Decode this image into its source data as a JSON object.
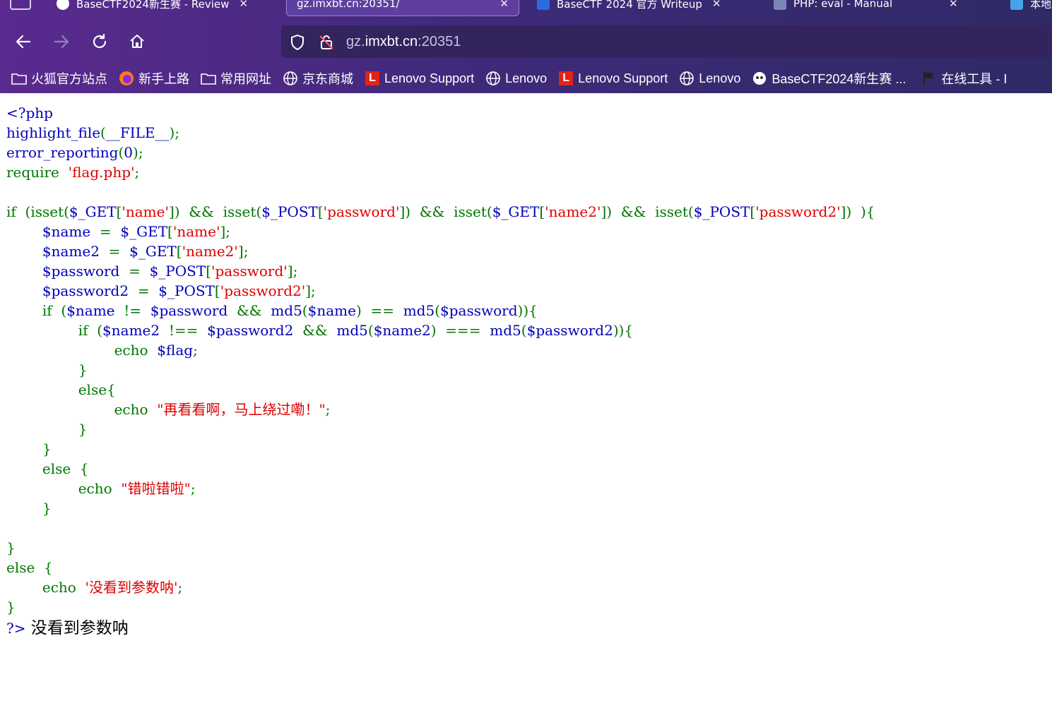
{
  "browser": {
    "tabs": [
      {
        "label": "BaseCTF2024新生赛 - Review",
        "active": false
      },
      {
        "label": "gz.imxbt.cn:20351/",
        "active": true
      },
      {
        "label": "BaseCTF 2024 官方 Writeup",
        "active": false
      },
      {
        "label": "PHP: eval - Manual",
        "active": false
      },
      {
        "label": "本地",
        "active": false
      }
    ],
    "url": {
      "scheme_host_prefix": "gz.",
      "host": "imxbt.cn",
      "port": ":20351"
    },
    "bookmarks": [
      {
        "label": "火狐官方站点",
        "icon": "folder-icon"
      },
      {
        "label": "新手上路",
        "icon": "firefox-icon"
      },
      {
        "label": "常用网址",
        "icon": "folder-icon"
      },
      {
        "label": "京东商城",
        "icon": "globe-icon"
      },
      {
        "label": "Lenovo Support",
        "icon": "lenovo-icon"
      },
      {
        "label": "Lenovo",
        "icon": "globe-icon"
      },
      {
        "label": "Lenovo Support",
        "icon": "lenovo-icon"
      },
      {
        "label": "Lenovo",
        "icon": "globe-icon"
      },
      {
        "label": "BaseCTF2024新生赛 ...",
        "icon": "basectf-icon"
      },
      {
        "label": "在线工具 - I",
        "icon": "flag-icon"
      }
    ]
  },
  "page": {
    "code_lines": [
      [
        [
          "d",
          "<?php"
        ]
      ],
      [
        [
          "d",
          "highlight_file"
        ],
        [
          "k",
          "("
        ],
        [
          "d",
          "__FILE__"
        ],
        [
          "k",
          ");"
        ]
      ],
      [
        [
          "d",
          "error_reporting"
        ],
        [
          "k",
          "("
        ],
        [
          "d",
          "0"
        ],
        [
          "k",
          ");"
        ]
      ],
      [
        [
          "k",
          "require  "
        ],
        [
          "s",
          "'flag.php'"
        ],
        [
          "k",
          ";"
        ]
      ],
      [],
      [
        [
          "k",
          "if  (isset("
        ],
        [
          "d",
          "$_GET"
        ],
        [
          "k",
          "["
        ],
        [
          "s",
          "'name'"
        ],
        [
          "k",
          "])  &&  isset("
        ],
        [
          "d",
          "$_POST"
        ],
        [
          "k",
          "["
        ],
        [
          "s",
          "'password'"
        ],
        [
          "k",
          "])  &&  isset("
        ],
        [
          "d",
          "$_GET"
        ],
        [
          "k",
          "["
        ],
        [
          "s",
          "'name2'"
        ],
        [
          "k",
          "])  &&  isset("
        ],
        [
          "d",
          "$_POST"
        ],
        [
          "k",
          "["
        ],
        [
          "s",
          "'password2'"
        ],
        [
          "k",
          "])  ){"
        ]
      ],
      [
        [
          "k",
          "        "
        ],
        [
          "d",
          "$name  "
        ],
        [
          "k",
          "=  "
        ],
        [
          "d",
          "$_GET"
        ],
        [
          "k",
          "["
        ],
        [
          "s",
          "'name'"
        ],
        [
          "k",
          "];"
        ]
      ],
      [
        [
          "k",
          "        "
        ],
        [
          "d",
          "$name2  "
        ],
        [
          "k",
          "=  "
        ],
        [
          "d",
          "$_GET"
        ],
        [
          "k",
          "["
        ],
        [
          "s",
          "'name2'"
        ],
        [
          "k",
          "];"
        ]
      ],
      [
        [
          "k",
          "        "
        ],
        [
          "d",
          "$password  "
        ],
        [
          "k",
          "=  "
        ],
        [
          "d",
          "$_POST"
        ],
        [
          "k",
          "["
        ],
        [
          "s",
          "'password'"
        ],
        [
          "k",
          "];"
        ]
      ],
      [
        [
          "k",
          "        "
        ],
        [
          "d",
          "$password2  "
        ],
        [
          "k",
          "=  "
        ],
        [
          "d",
          "$_POST"
        ],
        [
          "k",
          "["
        ],
        [
          "s",
          "'password2'"
        ],
        [
          "k",
          "];"
        ]
      ],
      [
        [
          "k",
          "        if  ("
        ],
        [
          "d",
          "$name  "
        ],
        [
          "k",
          "!=  "
        ],
        [
          "d",
          "$password  "
        ],
        [
          "k",
          "&&  "
        ],
        [
          "d",
          "md5"
        ],
        [
          "k",
          "("
        ],
        [
          "d",
          "$name"
        ],
        [
          "k",
          ")  ==  "
        ],
        [
          "d",
          "md5"
        ],
        [
          "k",
          "("
        ],
        [
          "d",
          "$password"
        ],
        [
          "k",
          ")){"
        ]
      ],
      [
        [
          "k",
          "                if  ("
        ],
        [
          "d",
          "$name2  "
        ],
        [
          "k",
          "!==  "
        ],
        [
          "d",
          "$password2  "
        ],
        [
          "k",
          "&&  "
        ],
        [
          "d",
          "md5"
        ],
        [
          "k",
          "("
        ],
        [
          "d",
          "$name2"
        ],
        [
          "k",
          ")  ===  "
        ],
        [
          "d",
          "md5"
        ],
        [
          "k",
          "("
        ],
        [
          "d",
          "$password2"
        ],
        [
          "k",
          ")){"
        ]
      ],
      [
        [
          "k",
          "                        echo  "
        ],
        [
          "d",
          "$flag"
        ],
        [
          "k",
          ";"
        ]
      ],
      [
        [
          "k",
          "                }"
        ]
      ],
      [
        [
          "k",
          "                else{"
        ]
      ],
      [
        [
          "k",
          "                        echo  "
        ],
        [
          "s",
          "\"再看看啊，马上绕过嘞！\""
        ],
        [
          "k",
          ";"
        ]
      ],
      [
        [
          "k",
          "                }"
        ]
      ],
      [
        [
          "k",
          "        }"
        ]
      ],
      [
        [
          "k",
          "        else  {"
        ]
      ],
      [
        [
          "k",
          "                echo  "
        ],
        [
          "s",
          "\"错啦错啦\""
        ],
        [
          "k",
          ";"
        ]
      ],
      [
        [
          "k",
          "        }"
        ]
      ],
      [],
      [
        [
          "k",
          "}"
        ]
      ],
      [
        [
          "k",
          "else  {"
        ]
      ],
      [
        [
          "k",
          "        echo  "
        ],
        [
          "s",
          "'没看到参数呐'"
        ],
        [
          "k",
          ";"
        ]
      ],
      [
        [
          "k",
          "}"
        ]
      ]
    ],
    "closing_tag": "?>",
    "output_text": "没看到参数呐"
  },
  "colors": {
    "keyword": "#007700",
    "string": "#dd0000",
    "default": "#0000bb",
    "chrome_bg": "#4a2a85"
  }
}
